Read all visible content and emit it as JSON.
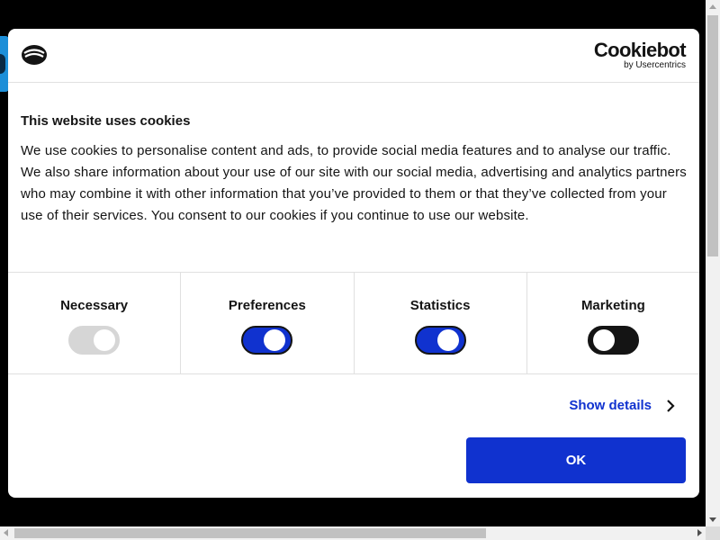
{
  "dialog": {
    "brand": {
      "name": "Cookiebot",
      "by": "by Usercentrics",
      "icon": "cookie-icon"
    },
    "title": "This website uses cookies",
    "body": "We use cookies to personalise content and ads, to provide social media features and to analyse our traffic. We also share information about your use of our site with our social media, advertising and analytics partners who may combine it with other information that you’ve provided to them or that they’ve collected from your use of their services. You consent to our cookies if you continue to use our website.",
    "categories": [
      {
        "label": "Necessary",
        "state": "on",
        "disabled": true
      },
      {
        "label": "Preferences",
        "state": "on",
        "disabled": false
      },
      {
        "label": "Statistics",
        "state": "on",
        "disabled": false
      },
      {
        "label": "Marketing",
        "state": "off",
        "disabled": false
      }
    ],
    "show_details": "Show details",
    "ok_label": "OK"
  },
  "colors": {
    "accent": "#1032cf",
    "text": "#141414",
    "toggle_off": "#141414",
    "toggle_disabled": "#d6d6d6"
  }
}
